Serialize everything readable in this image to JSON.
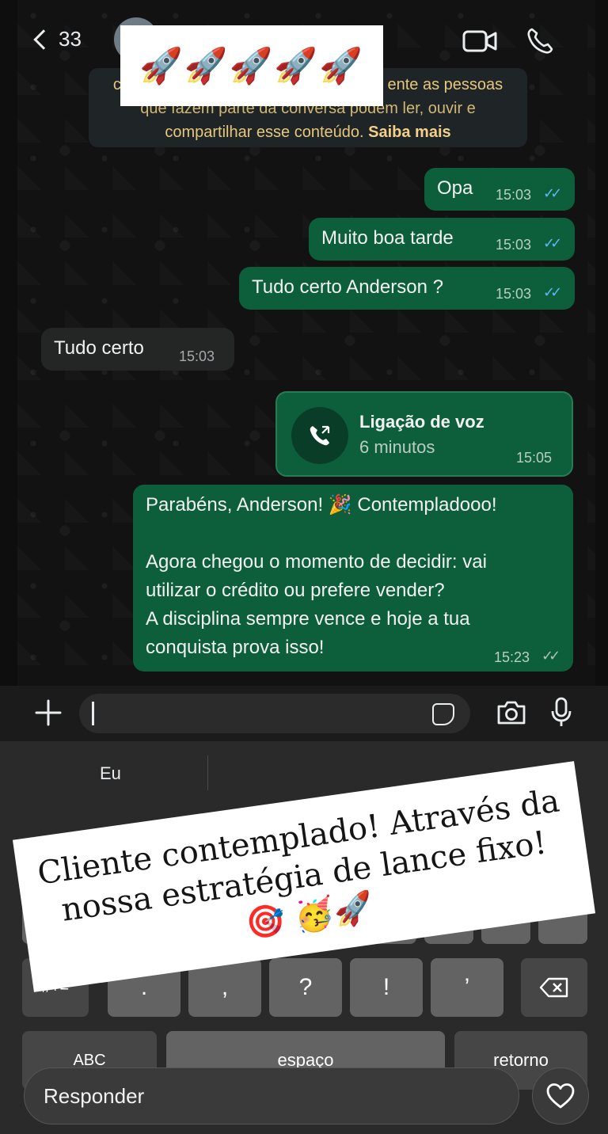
{
  "header": {
    "back_count": "33",
    "sticker_emoji": "🚀🚀🚀🚀🚀"
  },
  "notice": {
    "line1_start": "cr",
    "line1_end": "ente as pessoas",
    "line2_partial": "que fazem parte da conversa podem ler, ouvir e",
    "line3": "compartilhar esse conteúdo.",
    "learn_more": "Saiba mais"
  },
  "messages": [
    {
      "text": "Opa",
      "time": "15:03"
    },
    {
      "text": "Muito boa tarde",
      "time": "15:03"
    },
    {
      "text": "Tudo certo Anderson ?",
      "time": "15:03"
    },
    {
      "text": "Tudo certo",
      "time": "15:03"
    }
  ],
  "call": {
    "title": "Ligação de voz",
    "duration": "6 minutos",
    "time": "15:05"
  },
  "long_message": {
    "text": "Parabéns, Anderson! 🎉 Contempladooo!\n\nAgora chegou o momento de decidir: vai\nutilizar o crédito ou prefere vender?\nA disciplina sempre vence e hoje a tua\nconquista prova isso!",
    "time": "15:23"
  },
  "keyboard": {
    "suggestion": "Eu",
    "row2": [
      "(",
      ")",
      "$",
      "&",
      "@",
      "”"
    ],
    "row3_mode": "#+=",
    "row3": [
      ".",
      ",",
      "?",
      "!",
      "’"
    ],
    "abc": "ABC",
    "space": "espaço",
    "return": "retorno"
  },
  "caption": {
    "text": "Cliente contemplado! Através da nossa estratégia de lance fixo! 🎯 🥳🚀"
  },
  "reply": {
    "placeholder": "Responder"
  },
  "colors": {
    "outgoing_bubble": "#0d5f3c",
    "incoming_bubble": "#242626",
    "read_ticks": "#5ab9f0"
  }
}
